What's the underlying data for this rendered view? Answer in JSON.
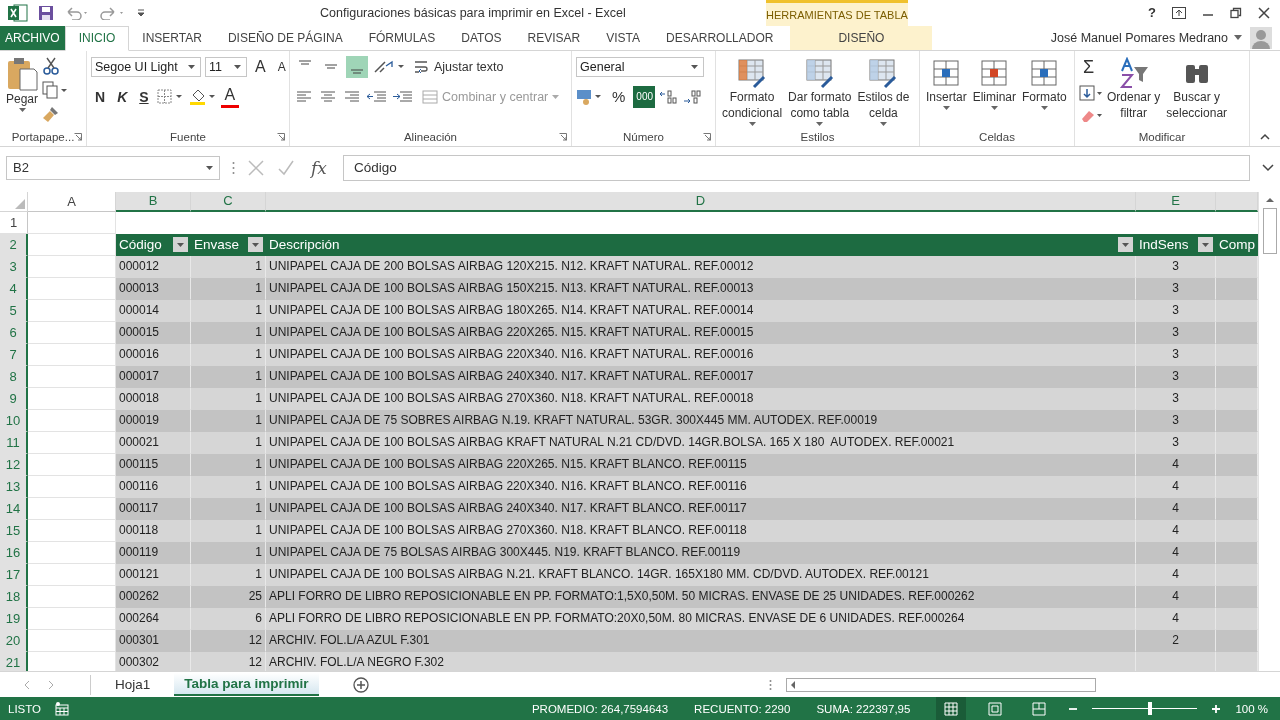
{
  "title_bar": {
    "title": "Configuraciones básicas para imprimir en Excel - Excel",
    "context_label": "HERRAMIENTAS DE TABLA",
    "help": "?",
    "user": "José Manuel Pomares Medrano"
  },
  "ribbon_tabs": [
    {
      "label": "ARCHIVO",
      "kind": "file",
      "selected": false
    },
    {
      "label": "INICIO",
      "kind": "normal",
      "selected": true
    },
    {
      "label": "INSERTAR",
      "kind": "normal",
      "selected": false
    },
    {
      "label": "DISEÑO DE PÁGINA",
      "kind": "normal",
      "selected": false
    },
    {
      "label": "FÓRMULAS",
      "kind": "normal",
      "selected": false
    },
    {
      "label": "DATOS",
      "kind": "normal",
      "selected": false
    },
    {
      "label": "REVISAR",
      "kind": "normal",
      "selected": false
    },
    {
      "label": "VISTA",
      "kind": "normal",
      "selected": false
    },
    {
      "label": "DESARROLLADOR",
      "kind": "normal",
      "selected": false
    },
    {
      "label": "DISEÑO",
      "kind": "context",
      "selected": false
    }
  ],
  "ribbon": {
    "clipboard": {
      "paste": "Pegar",
      "label": "Portapape..."
    },
    "font": {
      "name": "Segoe UI Light",
      "size": "11",
      "grow": "A",
      "shrink": "A",
      "bold": "N",
      "italic": "K",
      "underline": "S",
      "color_letter": "A",
      "label": "Fuente"
    },
    "alignment": {
      "vertical": [
        {
          "selected": false
        },
        {
          "selected": false
        },
        {
          "selected": true
        }
      ],
      "wrap_text": "Ajustar texto",
      "merge": "Combinar y centrar",
      "merge_disabled": true,
      "label": "Alineación"
    },
    "number": {
      "format": "General",
      "percent": "%",
      "thousands": "000",
      "label": "Número"
    },
    "styles": {
      "buttons": [
        {
          "lines": [
            "Formato",
            "condicional"
          ]
        },
        {
          "lines": [
            "Dar formato",
            "como tabla"
          ]
        },
        {
          "lines": [
            "Estilos de",
            "celda"
          ]
        }
      ],
      "label": "Estilos"
    },
    "cells": {
      "buttons": [
        "Insertar",
        "Eliminar",
        "Formato"
      ],
      "label": "Celdas"
    },
    "editing": {
      "sum": "Σ",
      "buttons": [
        {
          "lines": [
            "Ordenar y",
            "filtrar"
          ]
        },
        {
          "lines": [
            "Buscar y",
            "seleccionar"
          ]
        }
      ],
      "label": "Modificar"
    }
  },
  "formula_bar": {
    "name_box": "B2",
    "function_label": "fx",
    "value": "Código"
  },
  "sheet": {
    "columns": [
      {
        "label": "A",
        "selected": false
      },
      {
        "label": "B",
        "selected": true
      },
      {
        "label": "C",
        "selected": true
      },
      {
        "label": "D",
        "selected": true
      },
      {
        "label": "E",
        "selected": true
      }
    ],
    "row_headers": [
      {
        "label": "1",
        "selected": false
      },
      {
        "label": "2",
        "selected": true
      },
      {
        "label": "3",
        "selected": true
      },
      {
        "label": "4",
        "selected": true
      },
      {
        "label": "5",
        "selected": true
      },
      {
        "label": "6",
        "selected": true
      },
      {
        "label": "7",
        "selected": true
      },
      {
        "label": "8",
        "selected": true
      },
      {
        "label": "9",
        "selected": true
      },
      {
        "label": "10",
        "selected": true
      },
      {
        "label": "11",
        "selected": true
      },
      {
        "label": "12",
        "selected": true
      },
      {
        "label": "13",
        "selected": true
      },
      {
        "label": "14",
        "selected": true
      },
      {
        "label": "15",
        "selected": true
      },
      {
        "label": "16",
        "selected": true
      },
      {
        "label": "17",
        "selected": true
      },
      {
        "label": "18",
        "selected": true
      },
      {
        "label": "19",
        "selected": true
      },
      {
        "label": "20",
        "selected": true
      },
      {
        "label": "21",
        "selected": true
      }
    ]
  },
  "table": {
    "headers": [
      {
        "label": "Código",
        "filter": true
      },
      {
        "label": "Envase",
        "filter": true
      },
      {
        "label": "Descripción",
        "filter": true
      },
      {
        "label": "IndSens",
        "filter": true
      },
      {
        "label": "Comp"
      }
    ],
    "rows": [
      [
        "000012",
        "1",
        "UNIPAPEL CAJA DE 200 BOLSAS AIRBAG 120X215. N12. KRAFT NATURAL. REF.00012",
        "3"
      ],
      [
        "000013",
        "1",
        "UNIPAPEL CAJA DE 100 BOLSAS AIRBAG 150X215. N13. KRAFT NATURAL. REF.00013",
        "3"
      ],
      [
        "000014",
        "1",
        "UNIPAPEL CAJA DE 100 BOLSAS AIRBAG 180X265. N14. KRAFT NATURAL. REF.00014",
        "3"
      ],
      [
        "000015",
        "1",
        "UNIPAPEL CAJA DE 100 BOLSAS AIRBAG 220X265. N15. KRAFT NATURAL. REF.00015",
        "3"
      ],
      [
        "000016",
        "1",
        "UNIPAPEL CAJA DE 100 BOLSAS AIRBAG 220X340. N16. KRAFT NATURAL. REF.00016",
        "3"
      ],
      [
        "000017",
        "1",
        "UNIPAPEL CAJA DE 100 BOLSAS AIRBAG 240X340. N17. KRAFT NATURAL. REF.00017",
        "3"
      ],
      [
        "000018",
        "1",
        "UNIPAPEL CAJA DE 100 BOLSAS AIRBAG 270X360. N18. KRAFT NATURAL. REF.00018",
        "3"
      ],
      [
        "000019",
        "1",
        "UNIPAPEL CAJA DE 75 SOBRES AIRBAG N.19. KRAFT NATURAL. 53GR. 300X445 MM. AUTODEX. REF.00019",
        "3"
      ],
      [
        "000021",
        "1",
        "UNIPAPEL CAJA DE 100 BOLSAS AIRBAG KRAFT NATURAL N.21 CD/DVD. 14GR.BOLSA. 165 X 180  AUTODEX. REF.00021",
        "3"
      ],
      [
        "000115",
        "1",
        "UNIPAPEL CAJA DE 100 BOLSAS AIRBAG 220X265. N15. KRAFT BLANCO. REF.00115",
        "4"
      ],
      [
        "000116",
        "1",
        "UNIPAPEL CAJA DE 100 BOLSAS AIRBAG 220X340. N16. KRAFT BLANCO. REF.00116",
        "4"
      ],
      [
        "000117",
        "1",
        "UNIPAPEL CAJA DE 100 BOLSAS AIRBAG 240X340. N17. KRAFT BLANCO. REF.00117",
        "4"
      ],
      [
        "000118",
        "1",
        "UNIPAPEL CAJA DE 100 BOLSAS AIRBAG 270X360. N18. KRAFT BLANCO. REF.00118",
        "4"
      ],
      [
        "000119",
        "1",
        "UNIPAPEL CAJA DE 75 BOLSAS AIRBAG 300X445. N19. KRAFT BLANCO. REF.00119",
        "4"
      ],
      [
        "000121",
        "1",
        "UNIPAPEL CAJA DE 100 BOLSAS AIRBAG N.21. KRAFT BLANCO. 14GR. 165X180 MM. CD/DVD. AUTODEX. REF.00121",
        "4"
      ],
      [
        "000262",
        "25",
        "APLI FORRO DE LIBRO REPOSICIONABLE EN PP. FORMATO:1,5X0,50M. 50 MICRAS. ENVASE DE 25 UNIDADES. REF.000262",
        "4"
      ],
      [
        "000264",
        "6",
        "APLI FORRO DE LIBRO REPOSICIONABLE EN PP. FORMATO:20X0,50M. 80 MICRAS. ENVASE DE 6 UNIDADES. REF.000264",
        "4"
      ],
      [
        "000301",
        "12",
        "ARCHIV. FOL.L/A AZUL F.301",
        "2"
      ],
      [
        "000302",
        "12",
        "ARCHIV. FOL.L/A NEGRO F.302"
      ]
    ]
  },
  "sheet_tabs": [
    {
      "label": "Hoja1",
      "selected": false
    },
    {
      "label": "Tabla para imprimir",
      "selected": true
    }
  ],
  "status_bar": {
    "mode": "LISTO",
    "stats": [
      "PROMEDIO: 264,7594643",
      "RECUENTO: 2290",
      "SUMA: 222397,95"
    ],
    "views": [
      {
        "selected": true
      },
      {
        "selected": false
      },
      {
        "selected": false
      }
    ],
    "zoom": {
      "level": 0.55,
      "label": "100 %"
    }
  }
}
